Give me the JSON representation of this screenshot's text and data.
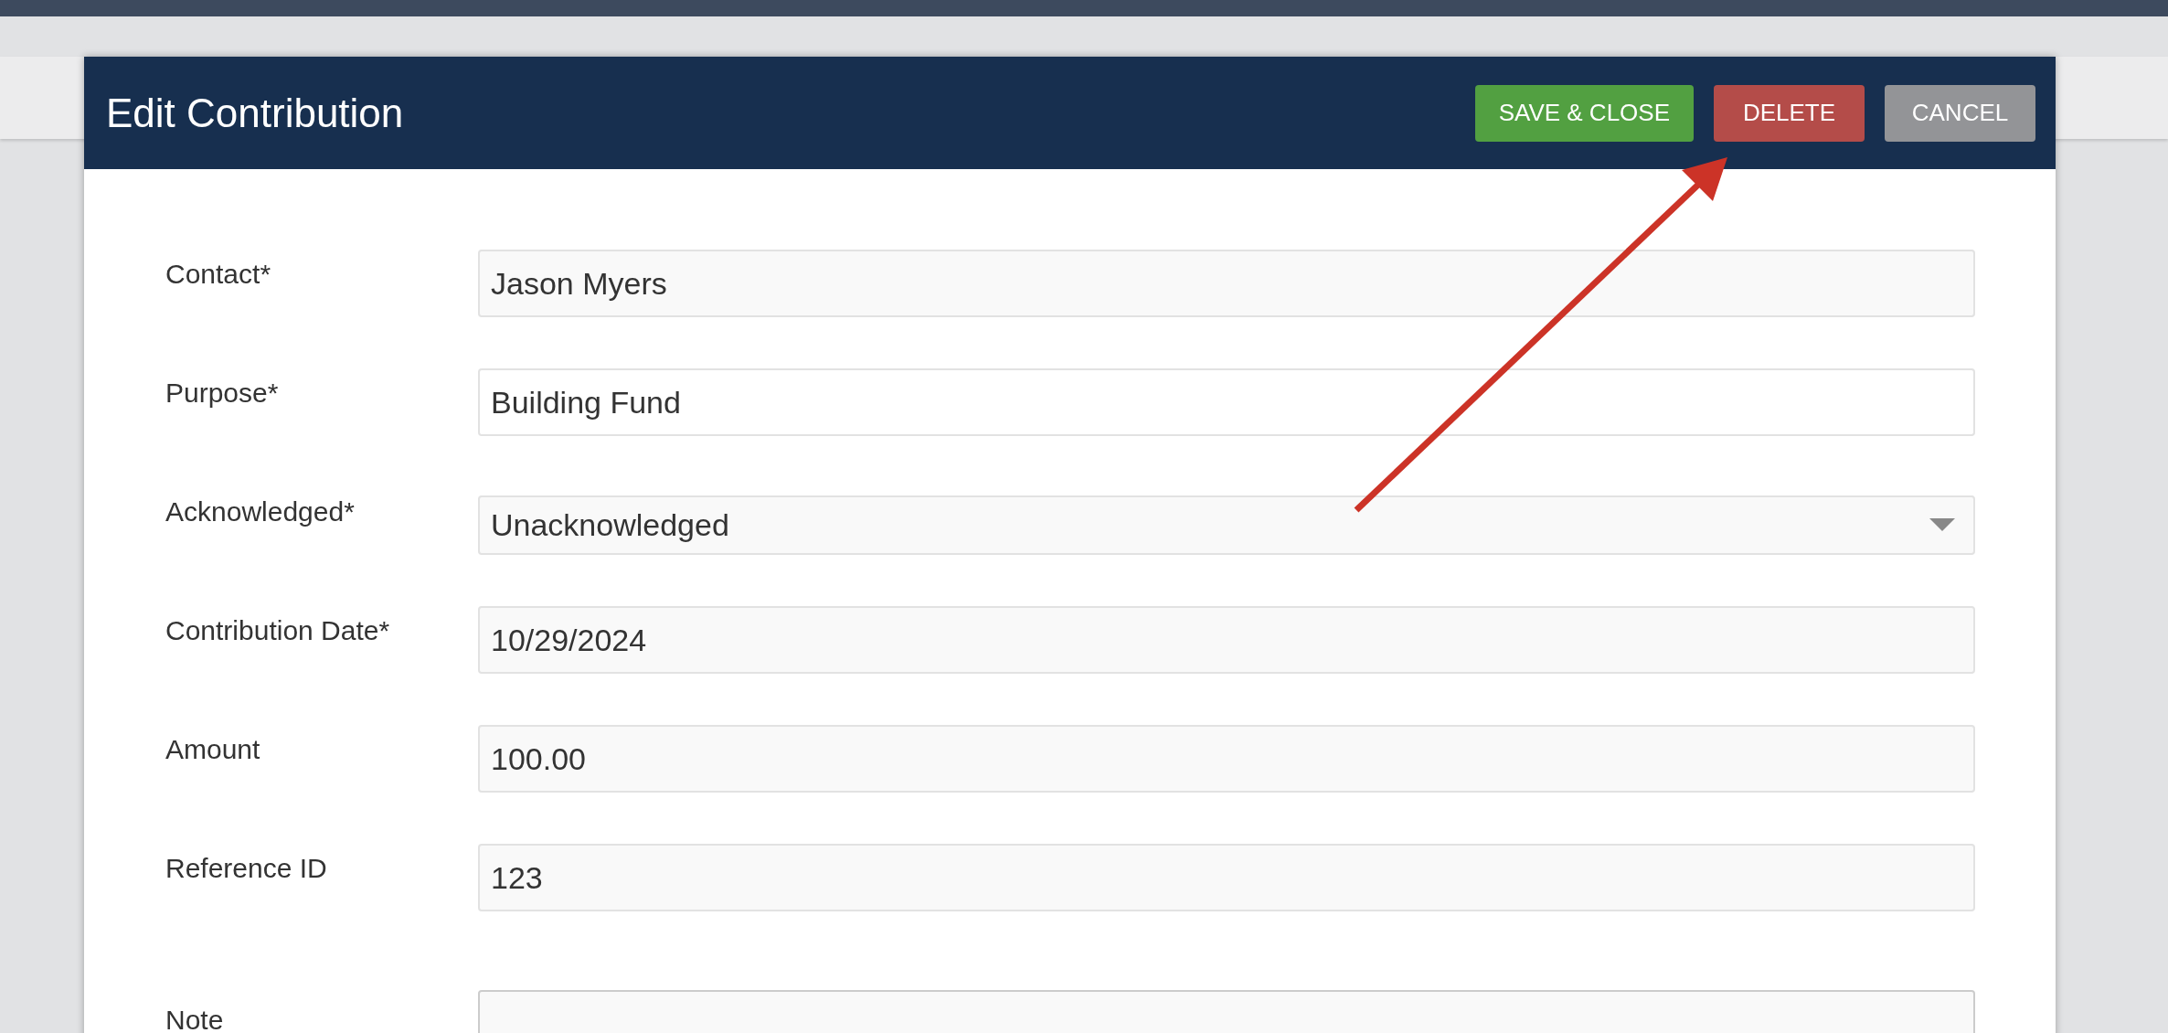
{
  "dialog": {
    "title": "Edit Contribution",
    "buttons": [
      {
        "label": "SAVE & CLOSE",
        "kind": "save"
      },
      {
        "label": "DELETE",
        "kind": "delete"
      },
      {
        "label": "CANCEL",
        "kind": "cancel"
      }
    ]
  },
  "fields": [
    {
      "label": "Contact*",
      "kind": "text",
      "value": "Jason Myers"
    },
    {
      "label": "Purpose*",
      "kind": "lookup",
      "value": "Building Fund"
    },
    {
      "label": "Acknowledged*",
      "kind": "select",
      "value": "Unacknowledged"
    },
    {
      "label": "Contribution Date*",
      "kind": "text",
      "value": "10/29/2024"
    },
    {
      "label": "Amount",
      "kind": "text",
      "value": "100.00"
    },
    {
      "label": "Reference ID",
      "kind": "text",
      "value": "123"
    },
    {
      "label": "Note",
      "kind": "textarea"
    }
  ]
}
